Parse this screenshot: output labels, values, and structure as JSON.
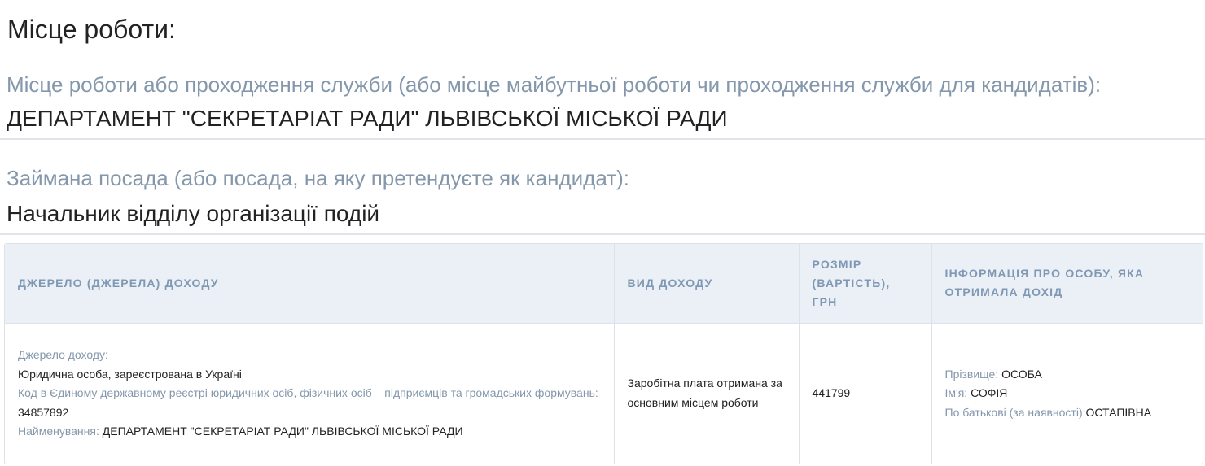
{
  "section": {
    "title": "Місце роботи:"
  },
  "workplace": {
    "label": "Місце роботи або проходження служби (або місце майбутньої роботи чи проходження служби для кандидатів):",
    "value": "ДЕПАРТАМЕНТ \"СЕКРЕТАРІАТ РАДИ\" ЛЬВІВСЬКОЇ МІСЬКОЇ РАДИ"
  },
  "position": {
    "label": "Займана посада (або посада, на яку претендуєте як кандидат):",
    "value": "Начальник відділу організації подій"
  },
  "income_table": {
    "headers": [
      "ДЖЕРЕЛО (ДЖЕРЕЛА) ДОХОДУ",
      "ВИД ДОХОДУ",
      "РОЗМІР (ВАРТІСТЬ), ГРН",
      "ІНФОРМАЦІЯ ПРО ОСОБУ, ЯКА ОТРИМАЛА ДОХІД"
    ],
    "row": {
      "source_label": "Джерело доходу:",
      "source_value": "Юридична особа, зареєстрована в Україні",
      "code_label": "Код в Єдиному державному реєстрі юридичних осіб, фізичних осіб – підприємців та громадських формувань:",
      "code_value": "34857892",
      "name_label": "Найменування:",
      "name_value": "ДЕПАРТАМЕНТ \"СЕКРЕТАРІАТ РАДИ\" ЛЬВІВСЬКОЇ МІСЬКОЇ РАДИ",
      "income_type": "Заробітна плата отримана за основним місцем роботи",
      "amount": "441799",
      "surname_label": "Прізвище:",
      "surname_value": "ОСОБА",
      "first_name_label": "Ім'я:",
      "first_name_value": "СОФІЯ",
      "patronymic_label": "По батькові (за наявності):",
      "patronymic_value": "ОСТАПІВНА"
    }
  }
}
